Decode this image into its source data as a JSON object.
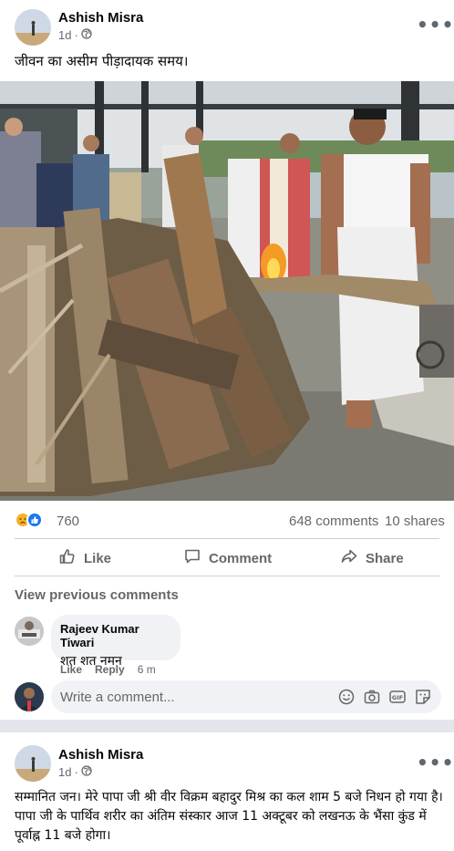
{
  "post1": {
    "author": "Ashish Misra",
    "time": "1d",
    "dot": "·",
    "caption": "जीवन का असीम पीड़ादायक समय।",
    "reactions_count": "760",
    "comments_count": "648 comments",
    "shares_count": "10 shares",
    "actions": {
      "like": "Like",
      "comment": "Comment",
      "share": "Share"
    },
    "view_previous": "View previous comments",
    "comment": {
      "name": "Rajeev Kumar Tiwari",
      "text": "शत शत नमन",
      "like": "Like",
      "reply": "Reply",
      "time": "6 m"
    },
    "write_placeholder": "Write a comment..."
  },
  "post2": {
    "author": "Ashish Misra",
    "time": "1d",
    "dot": "·",
    "caption": "सम्मानित जन। मेरे पापा जी श्री वीर विक्रम बहादुर मिश्र का कल शाम 5 बजे निधन हो गया है। पापा जी के पार्थिव शरीर का अंतिम संस्कार आज 11 अक्टूबर को लखनऊ के भैंसा कुंड में पूर्वाह्न 11 बजे होगा।"
  },
  "colors": {
    "like_blue": "#1877f2",
    "sad_yellow": "#f7b125",
    "secondary_text": "#65676b"
  },
  "icons": [
    "globe-icon",
    "more-icon",
    "like-icon",
    "comment-icon",
    "share-icon",
    "emoji-icon",
    "camera-icon",
    "gif-icon",
    "sticker-icon"
  ]
}
